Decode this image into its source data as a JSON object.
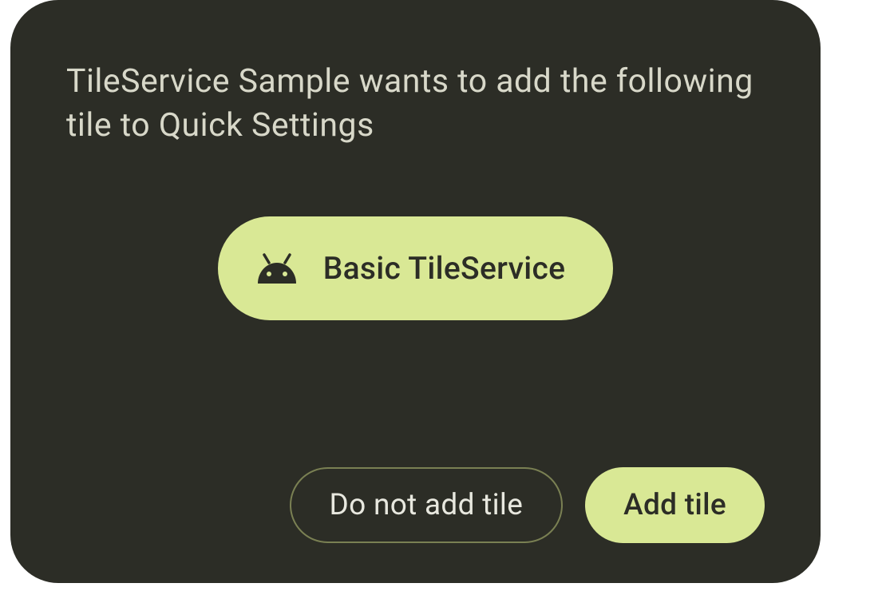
{
  "dialog": {
    "message": "TileService Sample wants to add the following tile to Quick Settings",
    "tile": {
      "label": "Basic TileService",
      "icon": "android-icon"
    },
    "buttons": {
      "decline": "Do not add tile",
      "accept": "Add tile"
    }
  },
  "colors": {
    "dialog_bg": "#2c2d26",
    "accent": "#d9e895",
    "text_light": "#d8d8c9",
    "text_dark": "#2c2d26",
    "outline": "#7a8053"
  }
}
